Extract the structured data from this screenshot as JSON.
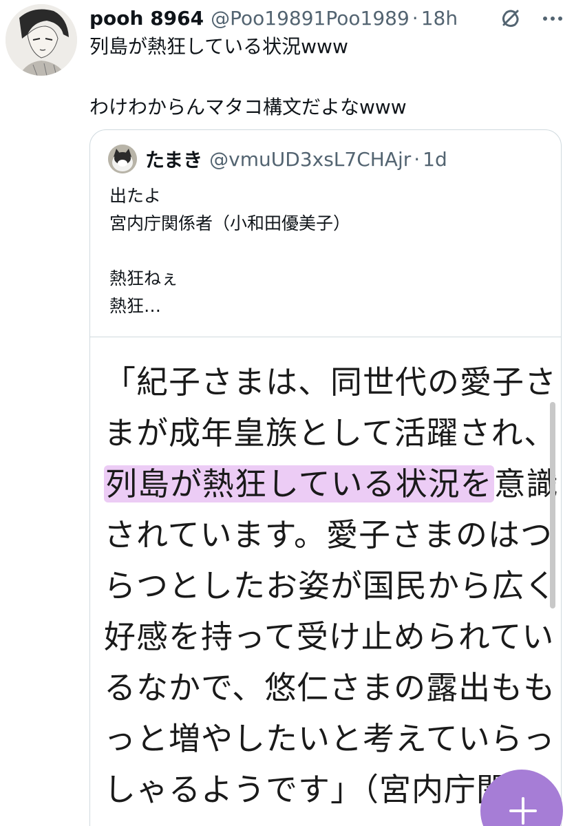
{
  "author": {
    "display_name": "pooh 8964",
    "handle": "@Poo19891Poo1989",
    "separator": "·",
    "time": "18h"
  },
  "tweet": {
    "line1": "列島が熱狂している状況www",
    "line2": "わけわからんマタコ構文だよなwww"
  },
  "quote": {
    "display_name": "たまき",
    "handle": "@vmuUD3xsL7CHAjr",
    "separator": "·",
    "time": "1d",
    "lines": [
      "出たよ",
      "宮内庁関係者（小和田優美子）",
      "熱狂ねぇ",
      "熱狂…"
    ]
  },
  "article": {
    "line1": "「紀子さまは、同世代の愛子さ",
    "line2": "まが成年皇族として活躍され、",
    "line3_highlight": "列島が熱狂している状況を",
    "line3_rest": "意識",
    "line4": "されています。愛子さまのはつ",
    "line5": "らつとしたお姿が国民から広く",
    "line6": "好感を持って受け止められてい",
    "line7": "るなかで、悠仁さまの露出もも",
    "line8": "っと増やしたいと考えていらっ",
    "line9": "しゃるようです」（宮内庁関係"
  },
  "colors": {
    "accent_fab": "#a67dd6",
    "highlight": "#cc78e6",
    "secondary_text": "#536471",
    "border": "#cfd9de"
  },
  "icons": {
    "grok": "grok-icon",
    "more": "more-icon",
    "compose": "plus-icon"
  }
}
